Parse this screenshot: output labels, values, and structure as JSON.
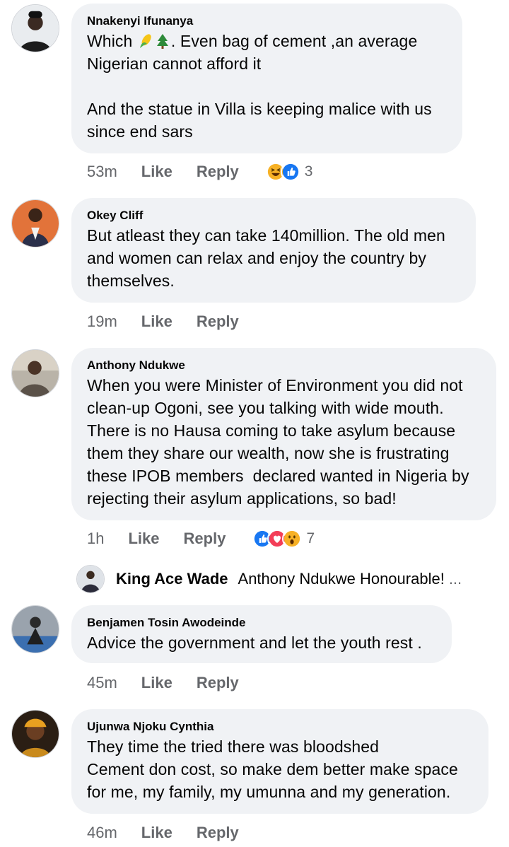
{
  "comments": [
    {
      "author": "Nnakenyi Ifunanya",
      "text_a": "Which ",
      "emoji_1": "corn-emoji",
      "emoji_2": "evergreen-tree-emoji",
      "text_b": ". Even bag of cement ,an average\nNigerian cannot afford it\n\nAnd the statue in Villa is keeping malice with us\nsince end sars",
      "time": "53m",
      "like": "Like",
      "reply": "Reply",
      "reactions": [
        "laughing-face-icon",
        "thumbs-up-icon"
      ],
      "reaction_count": "3"
    },
    {
      "author": "Okey Cliff",
      "text": "But atleast they can take 140million. The old men\nand women can relax and enjoy the country by\nthemselves.",
      "time": "19m",
      "like": "Like",
      "reply": "Reply"
    },
    {
      "author": "Anthony Ndukwe",
      "text": "When you were Minister of Environment you did not\nclean-up Ogoni, see you talking with wide mouth.\nThere is no Hausa coming to take asylum because\nthem they share our wealth, now she is frustrating\nthese IPOB members  declared wanted in Nigeria by\nrejecting their asylum applications, so bad!",
      "time": "1h",
      "like": "Like",
      "reply": "Reply",
      "reactions": [
        "thumbs-up-icon",
        "heart-icon",
        "wow-face-icon"
      ],
      "reaction_count": "7"
    },
    {
      "author": "Benjamen Tosin Awodeinde",
      "text": "Advice the government and let the youth rest .",
      "time": "45m",
      "like": "Like",
      "reply": "Reply"
    },
    {
      "author": "Ujunwa Njoku Cynthia",
      "text": "They time the tried there was bloodshed\nCement don cost, so make dem better make space\nfor me, my family, my umunna and my generation.",
      "time": "46m",
      "like": "Like",
      "reply": "Reply"
    }
  ],
  "reply_preview": {
    "author": "King Ace Wade",
    "text": "Anthony Ndukwe Honourable!",
    "more": "..."
  },
  "colors": {
    "bubble": "#f0f2f5",
    "meta_text": "#65676b",
    "like_blue": "#1877f2",
    "love_red": "#f33e58",
    "haha_yellow": "#f7b125"
  }
}
